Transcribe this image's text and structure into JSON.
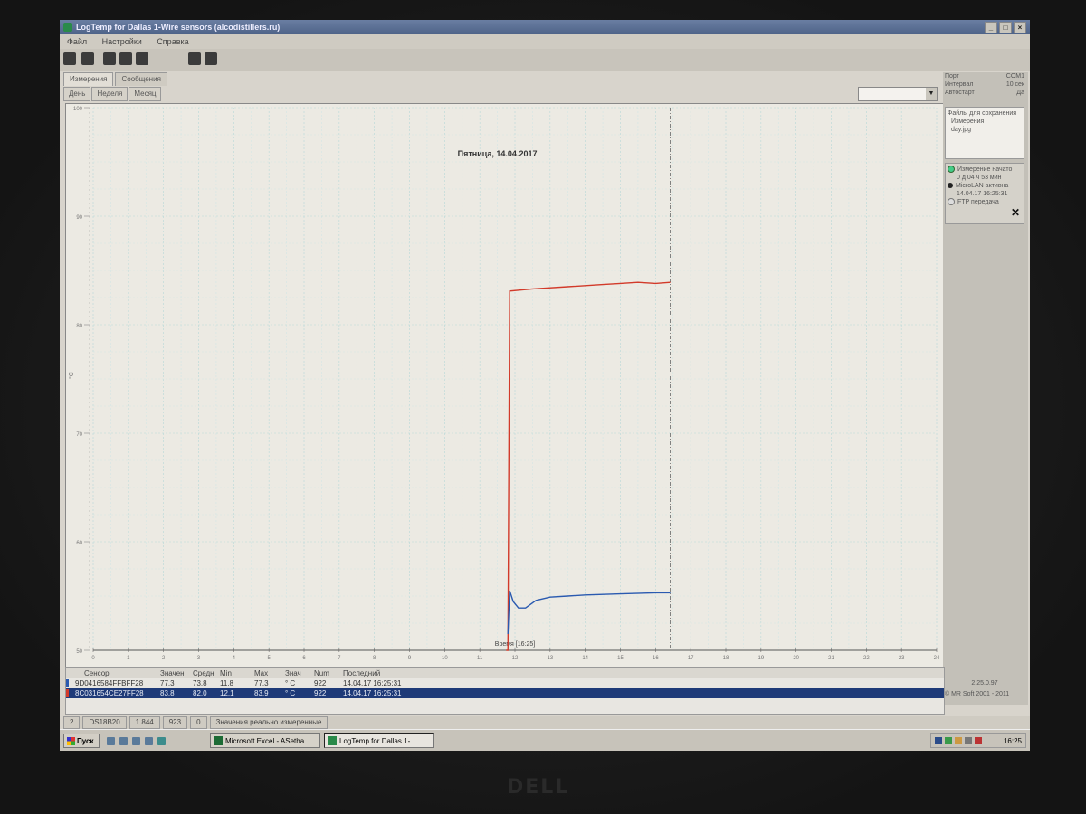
{
  "window": {
    "title": "LogTemp for Dallas 1-Wire sensors (alcodistillers.ru)"
  },
  "menu": [
    "Файл",
    "Настройки",
    "Справка"
  ],
  "tabs": [
    "Измерения",
    "Сообщения"
  ],
  "subtabs": [
    "День",
    "Неделя",
    "Месяц"
  ],
  "chart": {
    "title": "Пятница, 14.04.2017",
    "ylabel": "°C",
    "xlabel": "Время [16:25]",
    "y_ticks": [
      "100",
      "90",
      "80",
      "70",
      "60",
      "50"
    ],
    "x_ticks": [
      "0",
      "1",
      "2",
      "3",
      "4",
      "5",
      "6",
      "7",
      "8",
      "9",
      "10",
      "11",
      "12",
      "13",
      "14",
      "15",
      "16",
      "17",
      "18",
      "19",
      "20",
      "21",
      "22",
      "23",
      "24"
    ]
  },
  "chart_data": {
    "type": "line",
    "title": "Пятница, 14.04.2017",
    "xlabel": "Время [16:25]",
    "ylabel": "°C",
    "xlim": [
      0,
      24
    ],
    "ylim": [
      50,
      100
    ],
    "grid": true,
    "cursor_x": 16.42,
    "series": [
      {
        "name": "8C031654CE27FF28",
        "color": "#d23a2a",
        "x": [
          11.75,
          11.8,
          11.85,
          12.5,
          13.5,
          14.5,
          15.0,
          15.5,
          16.0,
          16.42
        ],
        "y": [
          50,
          50,
          83.1,
          83.3,
          83.5,
          83.7,
          83.8,
          83.9,
          83.8,
          83.9
        ]
      },
      {
        "name": "9D0416584FFBFF28",
        "color": "#2a5ab0",
        "x": [
          11.8,
          11.85,
          11.95,
          12.1,
          12.3,
          12.6,
          13.0,
          13.5,
          14.0,
          15.0,
          16.0,
          16.42
        ],
        "y": [
          51.5,
          55.5,
          54.5,
          53.9,
          53.9,
          54.6,
          54.9,
          55.0,
          55.1,
          55.2,
          55.3,
          55.3
        ]
      }
    ]
  },
  "right_panel": {
    "info": [
      {
        "label": "Порт",
        "value": "COM1"
      },
      {
        "label": "Интервал",
        "value": "10 сек"
      },
      {
        "label": "Автостарт",
        "value": "Да"
      }
    ],
    "files_title": "Файлы для сохранения",
    "files": [
      "Измерения",
      "day.jpg"
    ],
    "status": [
      {
        "text": "Измерение начато",
        "sub": "0 д 04 ч 53 мин",
        "state": "green"
      },
      {
        "text": "MicroLAN активна",
        "sub": "14.04.17 16:25:31",
        "state": "black"
      },
      {
        "text": "FTP передача",
        "sub": "",
        "state": "gray"
      }
    ],
    "version": "2.25.0.97",
    "copyright": "© MR Soft 2001 - 2011"
  },
  "table": {
    "headers": [
      "Сенсор",
      "Значен",
      "Средн",
      "Min",
      "Max",
      "Знач",
      "Num",
      "Последний"
    ],
    "rows": [
      {
        "idx": "1",
        "sensor": "9D0416584FFBFF28",
        "value": "77,3",
        "avg": "73,8",
        "min": "11,8",
        "max": "77,3",
        "unit": "° C",
        "num": "922",
        "last": "14.04.17 16:25:31",
        "color": "#2a5ab0"
      },
      {
        "idx": "1",
        "sensor": "8C031654CE27FF28",
        "value": "83,8",
        "avg": "82,0",
        "min": "12,1",
        "max": "83,9",
        "unit": "° C",
        "num": "922",
        "last": "14.04.17 16:25:31",
        "color": "#d23a2a"
      }
    ]
  },
  "statusbar": [
    "2",
    "DS18B20",
    "1 844",
    "923",
    "0",
    "Значения реально измеренные"
  ],
  "taskbar": {
    "start": "Пуск",
    "tasks": [
      "Microsoft Excel - ASetha...",
      "LogTemp for Dallas 1-..."
    ],
    "clock": "16:25"
  },
  "monitor_brand": "DELL"
}
